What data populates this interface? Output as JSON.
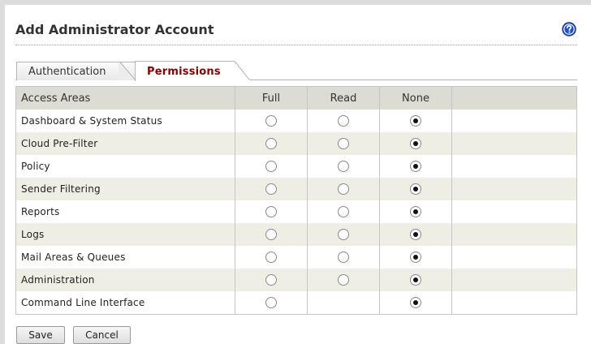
{
  "page": {
    "title": "Add Administrator Account"
  },
  "help": {
    "icon": "help-circle-icon",
    "color": "#1f4fd0"
  },
  "tabs": [
    {
      "label": "Authentication",
      "active": false
    },
    {
      "label": "Permissions",
      "active": true
    }
  ],
  "table": {
    "headers": [
      "Access Areas",
      "Full",
      "Read",
      "None"
    ],
    "rows": [
      {
        "area": "Dashboard & System Status",
        "options": [
          "full",
          "read",
          "none"
        ],
        "selected": "none"
      },
      {
        "area": "Cloud Pre-Filter",
        "options": [
          "full",
          "read",
          "none"
        ],
        "selected": "none"
      },
      {
        "area": "Policy",
        "options": [
          "full",
          "read",
          "none"
        ],
        "selected": "none"
      },
      {
        "area": "Sender Filtering",
        "options": [
          "full",
          "read",
          "none"
        ],
        "selected": "none"
      },
      {
        "area": "Reports",
        "options": [
          "full",
          "read",
          "none"
        ],
        "selected": "none"
      },
      {
        "area": "Logs",
        "options": [
          "full",
          "read",
          "none"
        ],
        "selected": "none"
      },
      {
        "area": "Mail Areas & Queues",
        "options": [
          "full",
          "read",
          "none"
        ],
        "selected": "none"
      },
      {
        "area": "Administration",
        "options": [
          "full",
          "read",
          "none"
        ],
        "selected": "none"
      },
      {
        "area": "Command Line Interface",
        "options": [
          "full",
          "none"
        ],
        "selected": "none"
      }
    ]
  },
  "buttons": {
    "save_label": "Save",
    "cancel_label": "Cancel"
  },
  "colors": {
    "active_tab_text": "#8b0000",
    "header_bg": "#dcdcd4",
    "stripe_bg": "#eeeee4"
  }
}
